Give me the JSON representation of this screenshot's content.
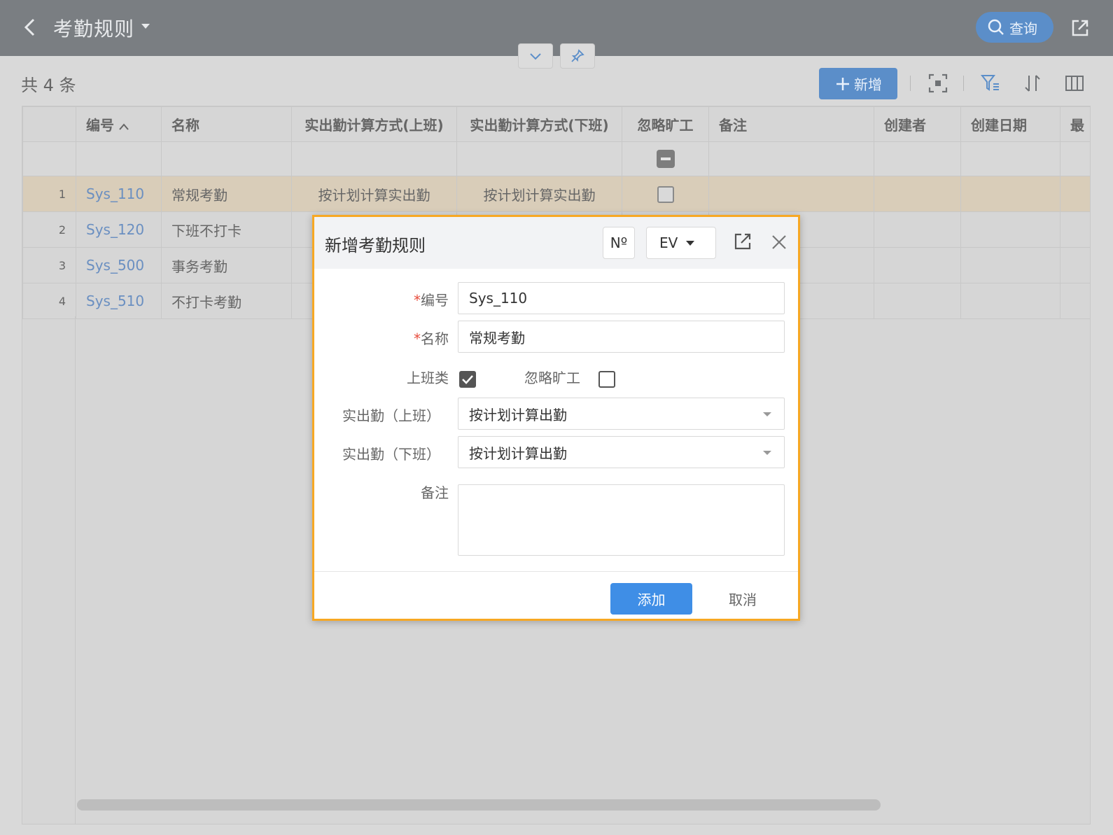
{
  "header": {
    "title": "考勤规则",
    "query_label": "查询"
  },
  "toolbar": {
    "count_label": "共 4 条",
    "add_label": "新增"
  },
  "table": {
    "columns": [
      "编号",
      "名称",
      "实出勤计算方式(上班)",
      "实出勤计算方式(下班)",
      "忽略旷工",
      "备注",
      "创建者",
      "创建日期",
      "最"
    ],
    "rows": [
      {
        "index": "1",
        "code": "Sys_110",
        "name": "常规考勤",
        "calc_on": "按计划计算实出勤",
        "calc_off": "按计划计算实出勤",
        "ignore_absence": false
      },
      {
        "index": "2",
        "code": "Sys_120",
        "name": "下班不打卡",
        "calc_on": "",
        "calc_off": "",
        "ignore_absence": false
      },
      {
        "index": "3",
        "code": "Sys_500",
        "name": "事务考勤",
        "calc_on": "",
        "calc_off": "",
        "ignore_absence": false
      },
      {
        "index": "4",
        "code": "Sys_510",
        "name": "不打卡考勤",
        "calc_on": "",
        "calc_off": "",
        "ignore_absence": false
      }
    ],
    "selected_row": 1
  },
  "modal": {
    "title": "新增考勤规则",
    "no_label": "Nº",
    "ev_label": "EV",
    "fields": {
      "code_label": "编号",
      "code_value": "Sys_110",
      "name_label": "名称",
      "name_value": "常规考勤",
      "work_type_label": "上班类",
      "work_type_checked": true,
      "ignore_label": "忽略旷工",
      "ignore_checked": false,
      "on_label": "实出勤（上班）",
      "on_value": "按计划计算出勤",
      "off_label": "实出勤（下班）",
      "off_value": "按计划计算出勤",
      "remark_label": "备注",
      "remark_value": ""
    },
    "submit_label": "添加",
    "cancel_label": "取消"
  },
  "colors": {
    "header_bg": "#7a7e82",
    "accent_blue": "#3f8ee6",
    "modal_border": "#f7a824",
    "link_blue": "#6a8fc1",
    "selected_row": "#d9cdb9"
  }
}
